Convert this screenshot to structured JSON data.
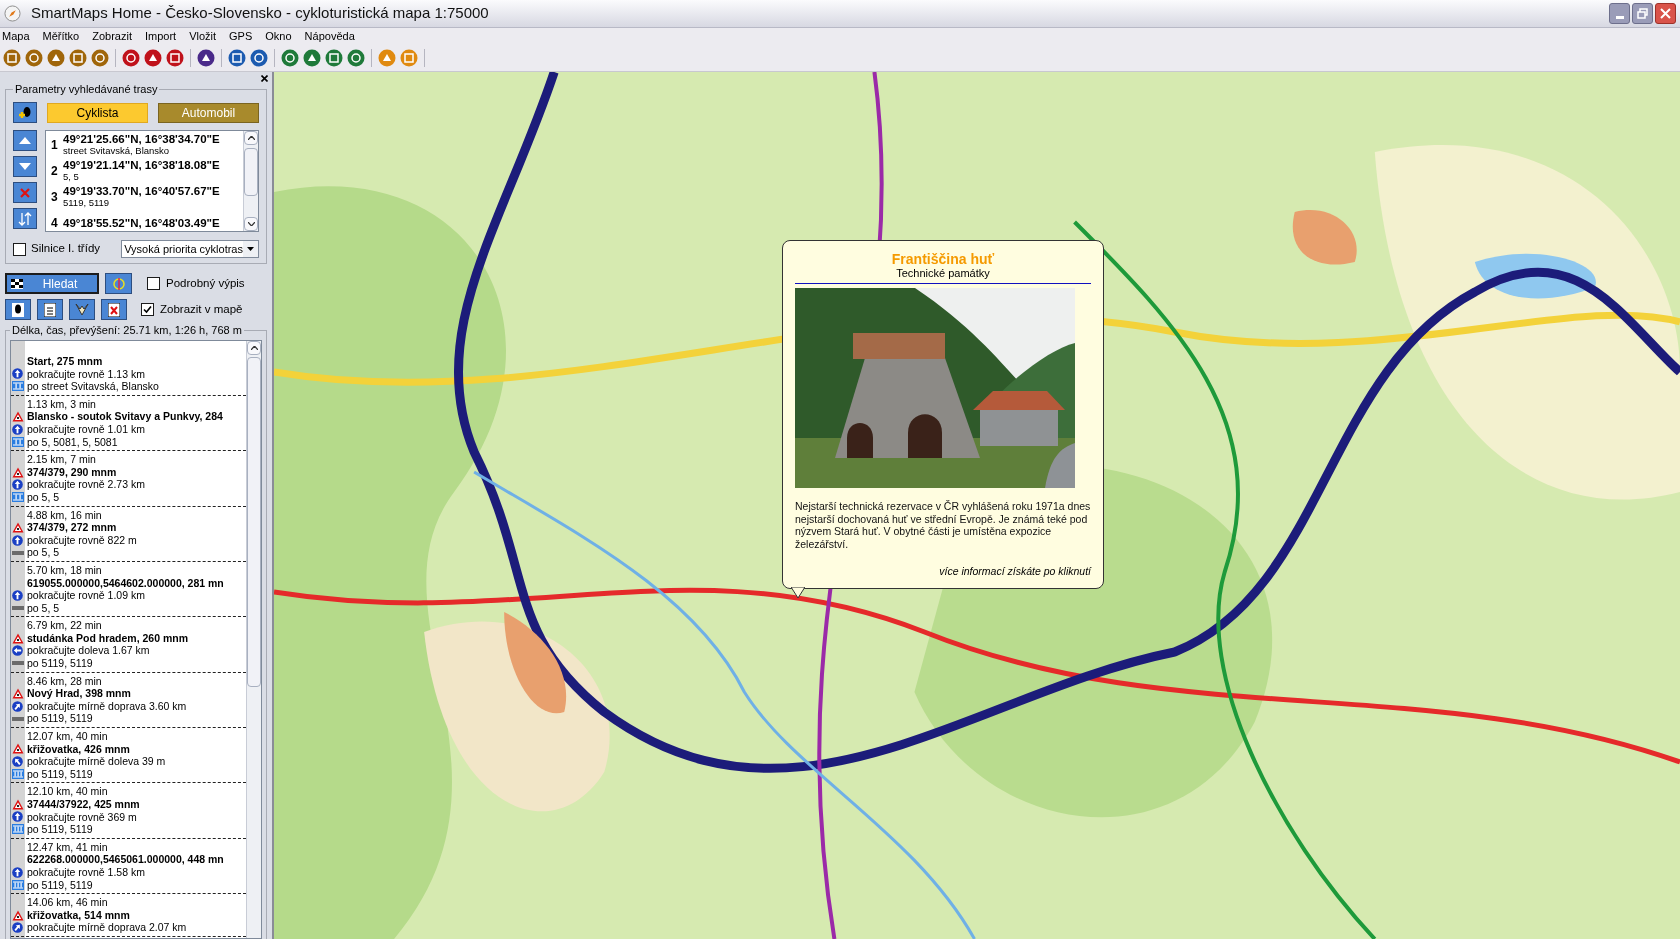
{
  "window": {
    "title": "SmartMaps Home - Česko-Slovensko - cykloturistická mapa 1:75000"
  },
  "menu": [
    "Mapa",
    "Měřítko",
    "Zobrazit",
    "Import",
    "Vložit",
    "GPS",
    "Okno",
    "Nápověda"
  ],
  "route_panel": {
    "group_title": "Parametry vyhledávané trasy",
    "modes": [
      {
        "label": "Cyklista",
        "selected": true
      },
      {
        "label": "Automobil",
        "selected": false
      }
    ],
    "waypoints": [
      {
        "number": "1",
        "coords": "49°21'25.66\"N, 16°38'34.70\"E",
        "address": "street Svitavská, Blansko"
      },
      {
        "number": "2",
        "coords": "49°19'21.14\"N, 16°38'18.08\"E",
        "address": "5, 5"
      },
      {
        "number": "3",
        "coords": "49°19'33.70\"N, 16°40'57.67\"E",
        "address": "5119, 5119"
      },
      {
        "number": "4",
        "coords": "49°18'55.52\"N, 16°48'03.49\"E"
      }
    ],
    "main_roads": {
      "label": "Silnice I. třídy",
      "checked": false
    },
    "priority": {
      "value": "Vysoká priorita cyklotras"
    },
    "search_button": "Hledat",
    "detailed_listing": {
      "label": "Podrobný výpis",
      "checked": false
    },
    "show_on_map": {
      "label": "Zobrazit v mapě",
      "checked": true
    },
    "summary_title": "Délka, čas, převýšení: 25.71 km, 1:26 h, 768 m",
    "steps": [
      {
        "place": "Start, 275 mnm",
        "warning": false,
        "direction": {
          "kind": "straight",
          "text": "pokračujte rovně 1.13 km"
        },
        "road": {
          "kind": "double",
          "text": "po street Svitavská, Blansko"
        }
      },
      {
        "distance": "1.13 km, 3 min",
        "place": "Blansko - soutok Svitavy a Punkvy, 284",
        "warning": true,
        "direction": {
          "kind": "straight",
          "text": "pokračujte rovně 1.01 km"
        },
        "road": {
          "kind": "double",
          "text": "po 5, 5081, 5, 5081"
        }
      },
      {
        "distance": "2.15 km, 7 min",
        "place": "374/379, 290 mnm",
        "warning": true,
        "direction": {
          "kind": "straight",
          "text": "pokračujte rovně 2.73 km"
        },
        "road": {
          "kind": "double",
          "text": "po 5, 5"
        }
      },
      {
        "distance": "4.88 km, 16 min",
        "place": "374/379, 272 mnm",
        "warning": true,
        "direction": {
          "kind": "straight",
          "text": "pokračujte rovně 822 m"
        },
        "road": {
          "kind": "plain",
          "text": "po 5, 5"
        }
      },
      {
        "distance": "5.70 km, 18 min",
        "place": "619055.000000,5464602.000000, 281 mn",
        "warning": false,
        "direction": {
          "kind": "straight",
          "text": "pokračujte rovně 1.09 km"
        },
        "road": {
          "kind": "plain",
          "text": "po 5, 5"
        }
      },
      {
        "distance": "6.79 km, 22 min",
        "place": "studánka Pod hradem, 260 mnm",
        "warning": true,
        "direction": {
          "kind": "left",
          "text": "pokračujte doleva 1.67 km"
        },
        "road": {
          "kind": "plain",
          "text": "po 5119, 5119"
        }
      },
      {
        "distance": "8.46 km, 28 min",
        "place": "Nový Hrad, 398 mnm",
        "warning": true,
        "direction": {
          "kind": "slight-right",
          "text": "pokračujte mírně doprava 3.60 km"
        },
        "road": {
          "kind": "plain",
          "text": "po 5119, 5119"
        }
      },
      {
        "distance": "12.07 km, 40 min",
        "place": "křižovatka, 426 mnm",
        "warning": true,
        "direction": {
          "kind": "slight-left",
          "text": "pokračujte mírně doleva 39 m"
        },
        "road": {
          "kind": "triple",
          "text": "po 5119, 5119"
        }
      },
      {
        "distance": "12.10 km, 40 min",
        "place": "37444/37922, 425 mnm",
        "warning": true,
        "direction": {
          "kind": "straight",
          "text": "pokračujte rovně 369 m"
        },
        "road": {
          "kind": "triple",
          "text": "po 5119, 5119"
        }
      },
      {
        "distance": "12.47 km, 41 min",
        "place": "622268.000000,5465061.000000, 448 mn",
        "warning": false,
        "direction": {
          "kind": "straight",
          "text": "pokračujte rovně 1.58 km"
        },
        "road": {
          "kind": "triple",
          "text": "po 5119, 5119"
        }
      },
      {
        "distance": "14.06 km, 46 min",
        "place": "křižovatka, 514 mnm",
        "warning": true,
        "direction": {
          "kind": "slight-right",
          "text": "pokračujte mírně doprava 2.07 km"
        }
      }
    ]
  },
  "map": {
    "popup": {
      "title": "Františčina huť",
      "category": "Technické památky",
      "description": "Nejstarší technická rezervace v ČR vyhlášená roku 1971a dnes nejstarší dochovaná huť ve střední Evropě. Je známá teké pod nýzvem Stará huť. V obytné části je umístěna expozice železářství.",
      "link": "více informací získáte po kliknutí"
    }
  }
}
